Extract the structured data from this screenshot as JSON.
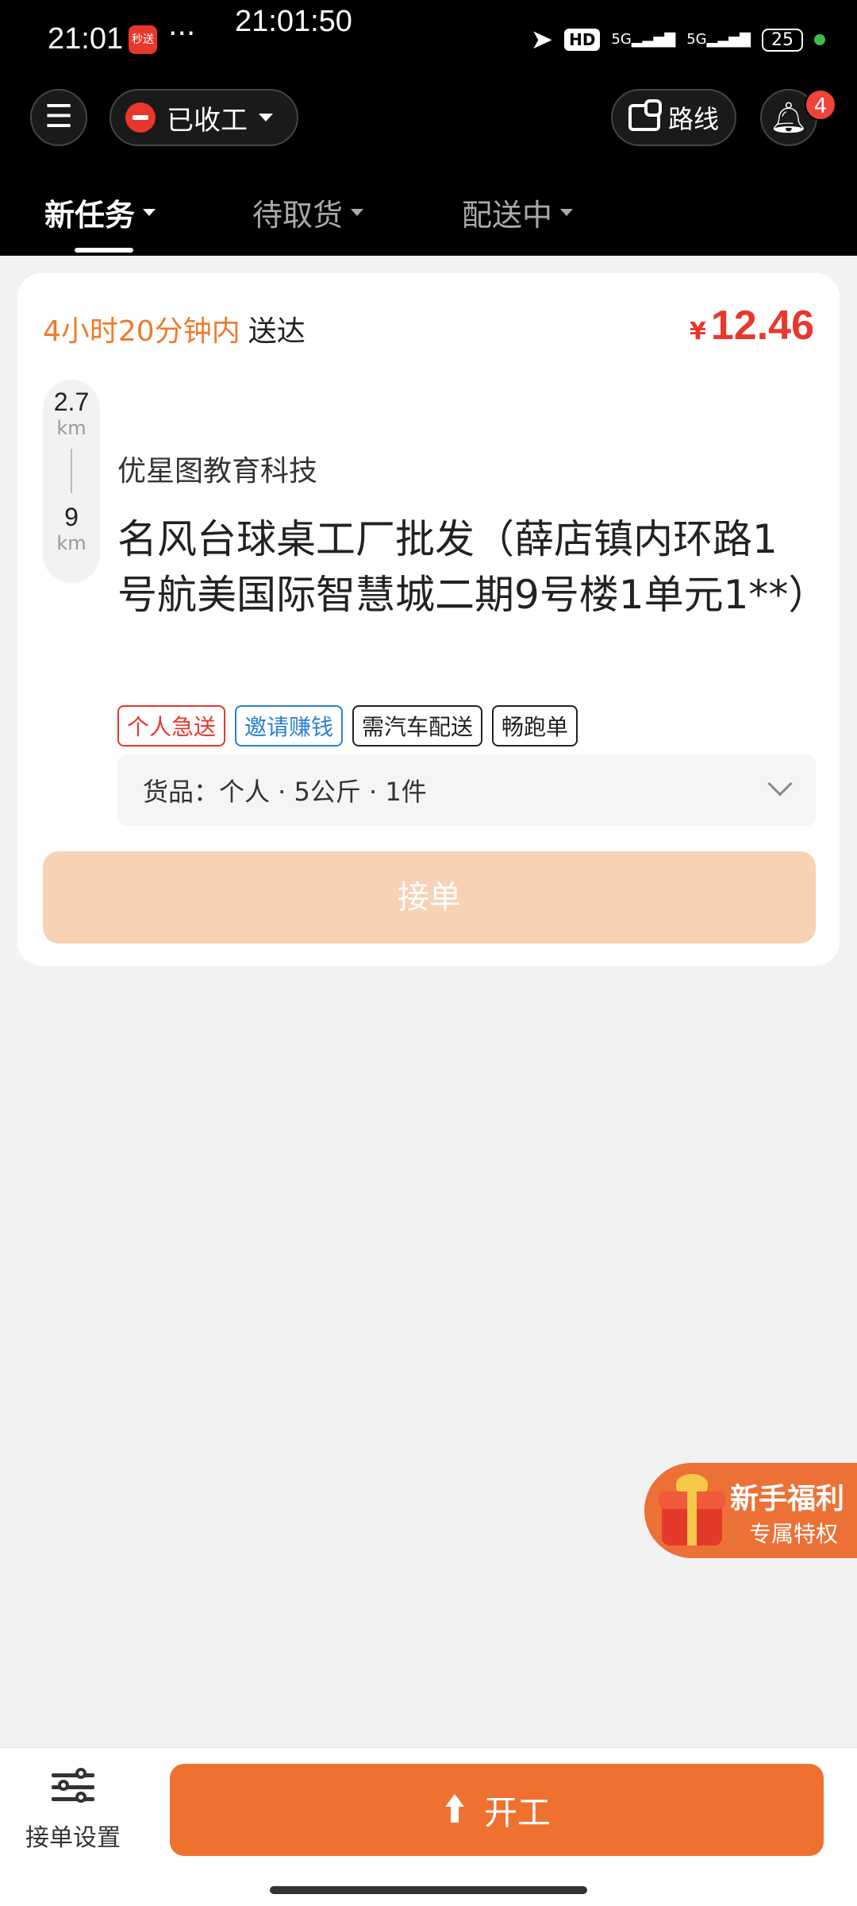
{
  "status_bar": {
    "time": "21:01",
    "app_badge": "秒送",
    "more": "···",
    "clock_overlay": "21:01:50",
    "hd_label": "HD",
    "signal_1": "5G",
    "signal_2": "5G",
    "battery": "25"
  },
  "header": {
    "work_status": "已收工",
    "route_label": "路线",
    "notification_count": "4"
  },
  "tabs": [
    {
      "label": "新任务",
      "active": true
    },
    {
      "label": "待取货",
      "active": false
    },
    {
      "label": "配送中",
      "active": false
    }
  ],
  "order": {
    "deadline_highlight": "4小时20分钟内",
    "deadline_suffix": "送达",
    "currency": "¥",
    "price": "12.46",
    "pickup_distance": "2.7",
    "pickup_unit": "km",
    "delivery_distance": "9",
    "delivery_unit": "km",
    "shop_name": "优星图教育科技",
    "address": "名风台球桌工厂批发（薛店镇内环路1号航美国际智慧城二期9号楼1单元1**）",
    "tags": [
      {
        "label": "个人急送",
        "color": "#e8372c"
      },
      {
        "label": "邀请赚钱",
        "color": "#2a7fd4"
      },
      {
        "label": "需汽车配送",
        "color": "#222222"
      },
      {
        "label": "畅跑单",
        "color": "#222222"
      }
    ],
    "goods": "货品：个人 · 5公斤 · 1件",
    "accept_label": "接单"
  },
  "promo": {
    "title": "新手福利",
    "subtitle": "专属特权"
  },
  "bottom_bar": {
    "settings_label": "接单设置",
    "start_label": "开工"
  },
  "colors": {
    "accent": "#ee7130",
    "price_red": "#e8372c",
    "deadline_orange": "#ee7b2e"
  }
}
